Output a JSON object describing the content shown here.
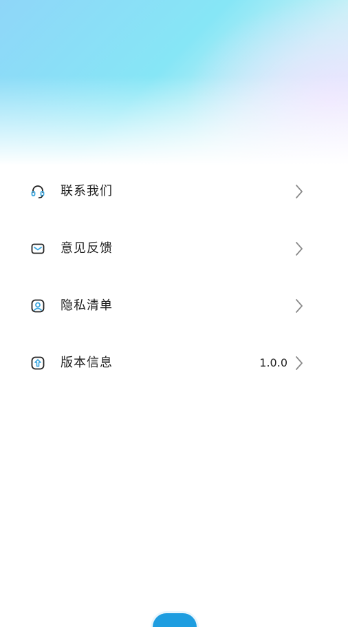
{
  "menu": {
    "items": [
      {
        "label": "联系我们",
        "icon": "headset-icon"
      },
      {
        "label": "意见反馈",
        "icon": "mail-icon"
      },
      {
        "label": "隐私清单",
        "icon": "privacy-icon"
      },
      {
        "label": "版本信息",
        "icon": "version-icon",
        "value": "1.0.0"
      }
    ]
  },
  "colors": {
    "accent": "#3aa6df",
    "text": "#1f1f1f",
    "chevron": "#8a8a8a"
  }
}
